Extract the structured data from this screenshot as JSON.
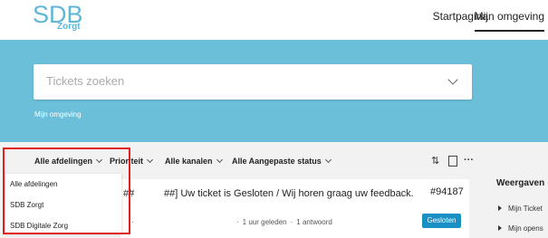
{
  "header": {
    "logo_text": "SDB",
    "logo_sub": "Zorgt",
    "nav": [
      "Startpagina",
      "Mijn omgeving"
    ]
  },
  "search": {
    "placeholder": "Tickets zoeken"
  },
  "breadcrumb": "Mijn omgeving",
  "filters": {
    "departments": "Alle afdelingen",
    "priority": "Prioriteit",
    "channels": "Alle kanalen",
    "status": "Alle Aangepaste status"
  },
  "dropdown": {
    "options": [
      "Alle afdelingen",
      "SDB Zorgt",
      "SDB Digitale Zorg"
    ]
  },
  "ticket": {
    "prefix": "##",
    "title": "##] Uw ticket is Gesloten / Wij horen graag uw feedback.",
    "id": "#94187",
    "time": "1 uur geleden",
    "replies": "1 antwoord",
    "status": "Gesloten"
  },
  "sidebar": {
    "title": "Weergaven",
    "items": [
      "Mijn Ticket",
      "Mijn opens"
    ]
  },
  "colors": {
    "hero": "#6cbfd8",
    "accent": "#1a8fc4",
    "highlight": "#e02020"
  }
}
